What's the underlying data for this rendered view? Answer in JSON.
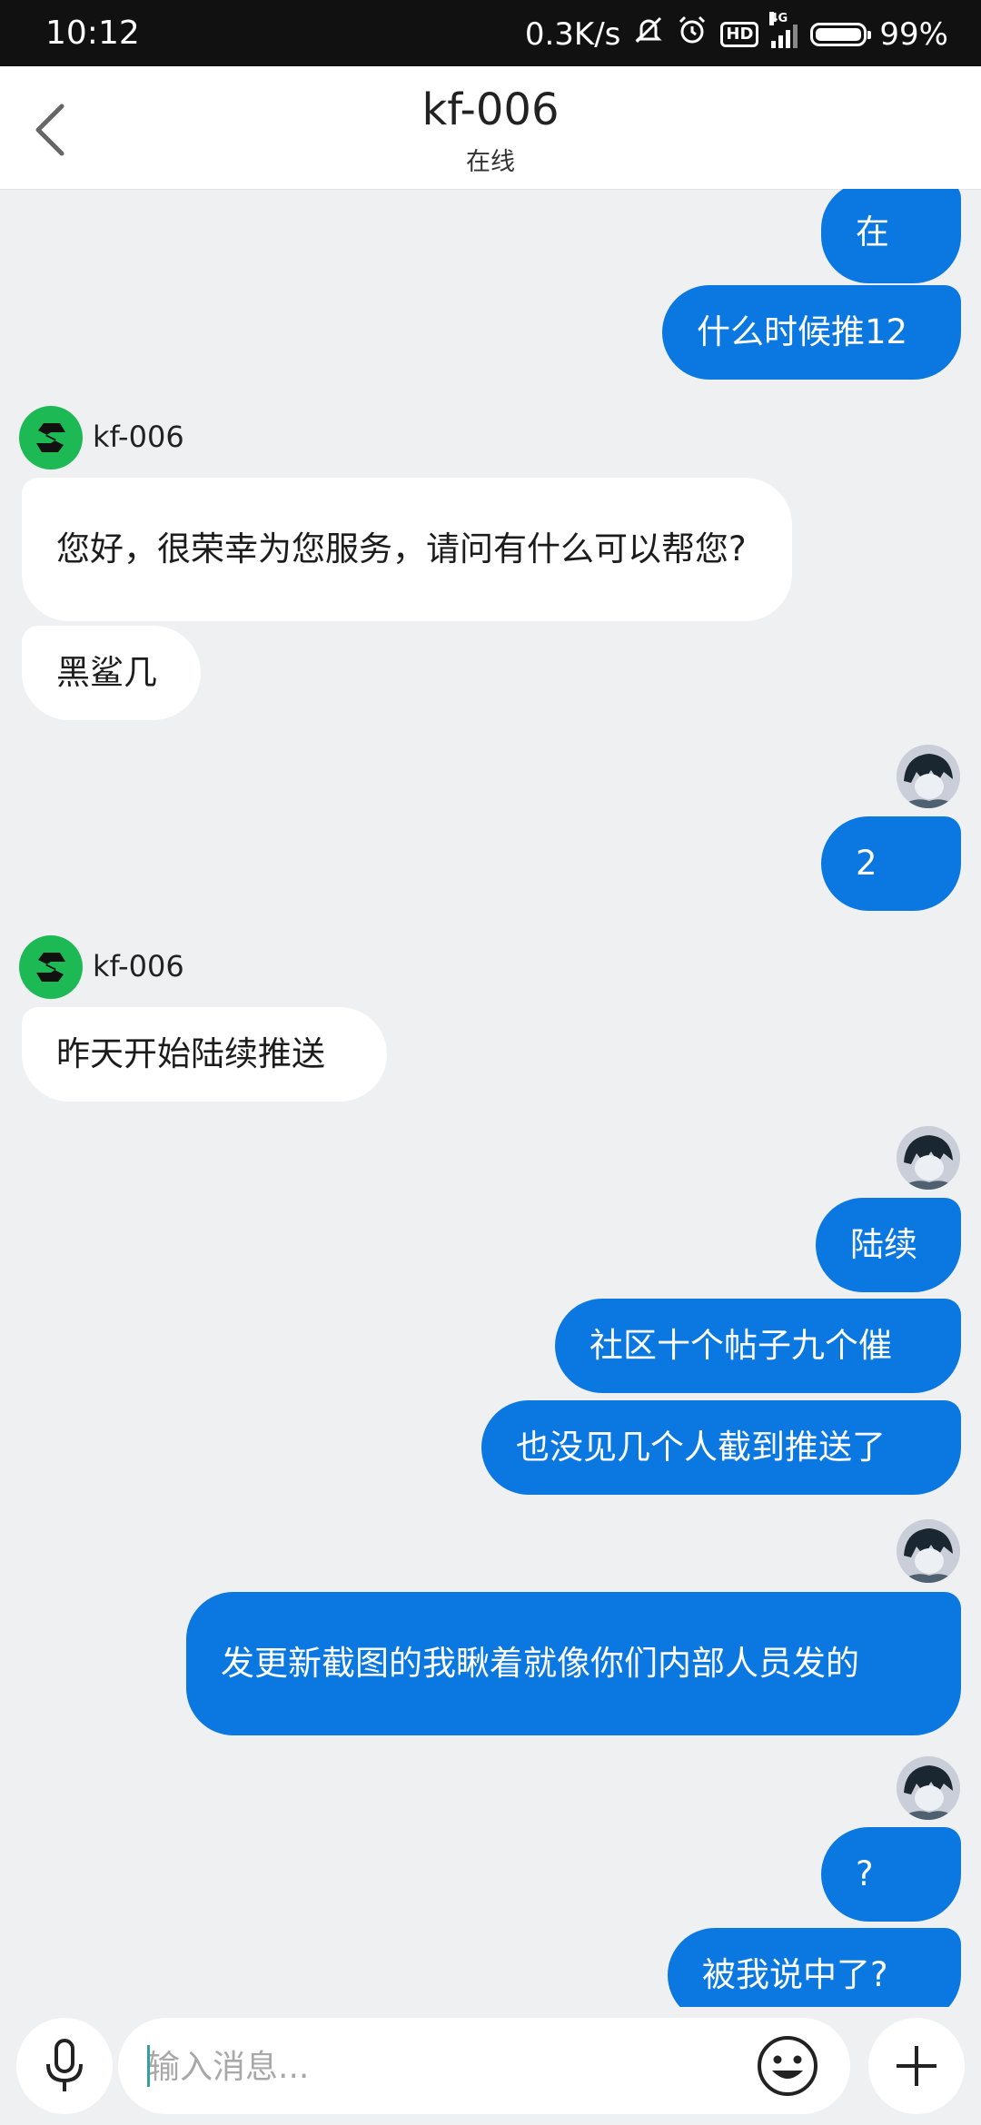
{
  "status_bar": {
    "time": "10:12",
    "net_speed": "0.3K/s",
    "hd": "HD",
    "network": "4G",
    "battery": "99%",
    "battery_level": 0.99
  },
  "header": {
    "title": "kf-006",
    "status": "在线"
  },
  "messages": [
    {
      "side": "mine",
      "text": "在"
    },
    {
      "side": "mine",
      "text": "什么时候推12"
    },
    {
      "side": "theirs",
      "sender": "kf-006",
      "text": "您好，很荣幸为您服务，请问有什么可以帮您?"
    },
    {
      "side": "theirs",
      "text": "黑鲨几"
    },
    {
      "side": "mine",
      "text": "2"
    },
    {
      "side": "theirs",
      "sender": "kf-006",
      "text": "昨天开始陆续推送"
    },
    {
      "side": "mine",
      "text": "陆续"
    },
    {
      "side": "mine",
      "text": "社区十个帖子九个催"
    },
    {
      "side": "mine",
      "text": "也没见几个人截到推送了"
    },
    {
      "side": "mine",
      "text": "发更新截图的我瞅着就像你们内部人员发的"
    },
    {
      "side": "mine",
      "text": "?"
    },
    {
      "side": "mine",
      "text": "被我说中了?"
    }
  ],
  "input": {
    "placeholder": "输入消息..."
  },
  "icons": {
    "back": "chevron-left-icon",
    "voice": "microphone-icon",
    "emoji": "smiley-icon",
    "more": "plus-icon"
  },
  "colors": {
    "my_bubble": "#0a78e0",
    "their_bubble": "#ffffff",
    "agent_avatar": "#1db954",
    "background": "#eff0f2"
  }
}
